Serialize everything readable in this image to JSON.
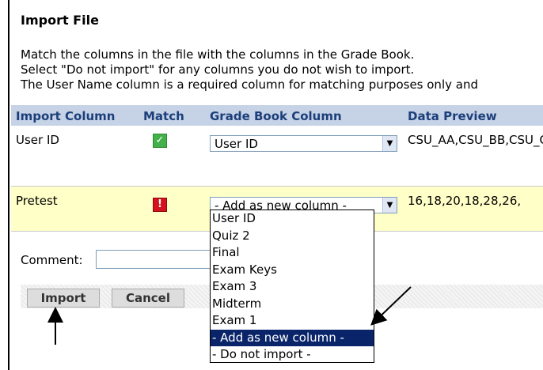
{
  "title": "Import File",
  "instructions": [
    "Match the columns in the file with the columns in the Grade Book.",
    "Select \"Do not import\" for any columns you do not wish to import.",
    "The User Name column is a required column for matching purposes only and"
  ],
  "table": {
    "headers": [
      "Import Column",
      "Match",
      "Grade Book Column",
      "Data Preview"
    ],
    "rows": [
      {
        "import_column": "User ID",
        "match": "ok",
        "grade_book_column": "User ID",
        "data_preview": "CSU_AA,CSU_BB,CSU_CC"
      },
      {
        "import_column": "Pretest",
        "match": "error",
        "grade_book_column": "- Add as new column -",
        "data_preview": "16,18,20,18,28,26,"
      }
    ]
  },
  "dropdown": {
    "options": [
      "User ID",
      "Quiz 2",
      "Final",
      "Exam Keys",
      "Exam 3",
      "Midterm",
      "Exam 1",
      "- Add as new column -",
      "- Do not import -"
    ],
    "selected_option": "- Add as new column -"
  },
  "comment": {
    "label": "Comment:",
    "value": ""
  },
  "buttons": {
    "import": "Import",
    "cancel": "Cancel"
  },
  "colors": {
    "header_bg": "#c6d2e6",
    "header_text": "#1c3f7a",
    "row_highlight": "#ffffc8",
    "selected_option_bg": "#0a246a",
    "match_ok": "#44b049",
    "match_error": "#d4111c"
  },
  "icons": {
    "match_ok": "check-icon",
    "match_error": "exclamation-icon"
  }
}
